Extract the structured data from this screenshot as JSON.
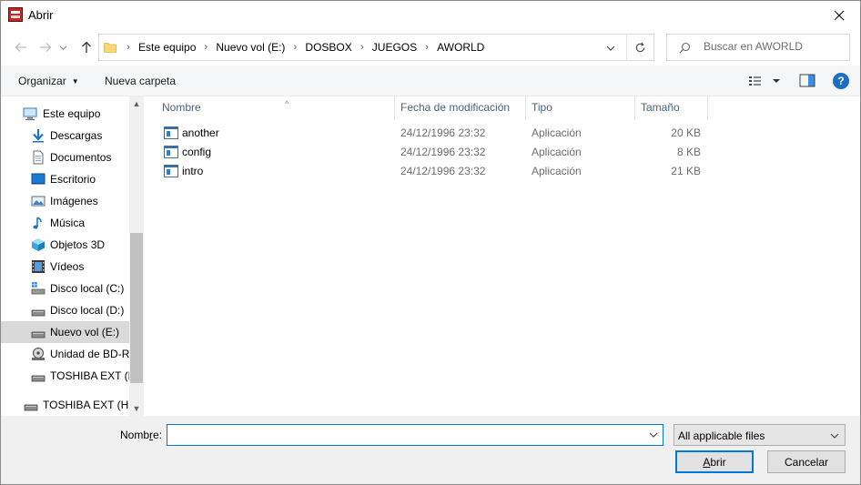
{
  "window": {
    "title": "Abrir",
    "app_icon": "dbgl-app-icon",
    "close_icon": "close-icon"
  },
  "nav": {
    "back_icon": "arrow-left-icon",
    "forward_icon": "arrow-right-icon",
    "recent_icon": "chevron-down-icon",
    "up_icon": "arrow-up-icon",
    "breadcrumbs": [
      "Este equipo",
      "Nuevo vol (E:)",
      "DOSBOX",
      "JUEGOS",
      "AWORLD"
    ],
    "refresh_icon": "refresh-icon",
    "search_placeholder": "Buscar en AWORLD"
  },
  "toolbar": {
    "organize_label": "Organizar",
    "new_folder_label": "Nueva carpeta",
    "view_icon": "details-view-icon",
    "preview_pane_icon": "preview-pane-icon",
    "help_icon_text": "?"
  },
  "sidebar": {
    "items": [
      {
        "label": "Este equipo",
        "icon": "computer-icon"
      },
      {
        "label": "Descargas",
        "icon": "downloads-icon"
      },
      {
        "label": "Documentos",
        "icon": "documents-icon"
      },
      {
        "label": "Escritorio",
        "icon": "desktop-icon"
      },
      {
        "label": "Imágenes",
        "icon": "pictures-icon"
      },
      {
        "label": "Música",
        "icon": "music-icon"
      },
      {
        "label": "Objetos 3D",
        "icon": "objects-3d-icon"
      },
      {
        "label": "Vídeos",
        "icon": "videos-icon"
      },
      {
        "label": "Disco local (C:)",
        "icon": "windows-drive-icon"
      },
      {
        "label": "Disco local (D:)",
        "icon": "drive-icon"
      },
      {
        "label": "Nuevo vol (E:)",
        "icon": "drive-icon",
        "selected": true
      },
      {
        "label": "Unidad de BD-RI",
        "icon": "optical-drive-icon"
      },
      {
        "label": "TOSHIBA EXT (H",
        "icon": "drive-icon"
      },
      {
        "label": "TOSHIBA EXT (H:)",
        "icon": "drive-icon"
      }
    ]
  },
  "filelist": {
    "columns": [
      "Nombre",
      "Fecha de modificación",
      "Tipo",
      "Tamaño"
    ],
    "rows": [
      {
        "name": "another",
        "date": "24/12/1996 23:32",
        "type": "Aplicación",
        "size": "20 KB"
      },
      {
        "name": "config",
        "date": "24/12/1996 23:32",
        "type": "Aplicación",
        "size": "8 KB"
      },
      {
        "name": "intro",
        "date": "24/12/1996 23:32",
        "type": "Aplicación",
        "size": "21 KB"
      }
    ]
  },
  "bottom": {
    "name_label_prefix": "Nomb",
    "name_label_underlined": "r",
    "name_label_suffix": "e:",
    "name_value": "",
    "filter_value": "All applicable files",
    "open_label_underlined": "A",
    "open_label_rest": "brir",
    "cancel_label": "Cancelar"
  },
  "colors": {
    "accent": "#0078d7",
    "folder": "#f8d775",
    "help": "#1a6fc4"
  }
}
